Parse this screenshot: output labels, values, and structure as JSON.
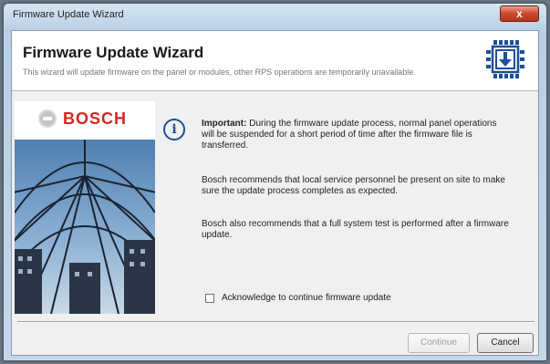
{
  "window": {
    "title": "Firmware Update Wizard",
    "close_glyph": "x"
  },
  "header": {
    "title": "Firmware Update Wizard",
    "subtitle": "This wizard will update firmware on the panel or modules, other RPS operations are temporarily unavailable.",
    "icon": "firmware-chip-download-icon"
  },
  "brand": {
    "name": "BOSCH",
    "color": "#d7261c",
    "icon": "bosch-logo-icon"
  },
  "body": {
    "info_icon": "info-icon",
    "info_glyph": "i",
    "important_label": "Important:",
    "important_text": "During the firmware update process, normal panel operations will be suspended for a short period of time after the firmware file is transferred.",
    "paragraph2": "Bosch recommends that local service personnel be present on site to make sure the update process completes as expected.",
    "paragraph3": "Bosch also recommends that a full system test is performed after a firmware update."
  },
  "acknowledge": {
    "label": "Acknowledge to continue firmware update",
    "checked": false
  },
  "buttons": {
    "continue_label": "Continue",
    "continue_enabled": false,
    "cancel_label": "Cancel"
  },
  "colors": {
    "info_blue": "#1c4f98",
    "title_bar": "#c4d7ea",
    "close_red": "#c8472d"
  }
}
